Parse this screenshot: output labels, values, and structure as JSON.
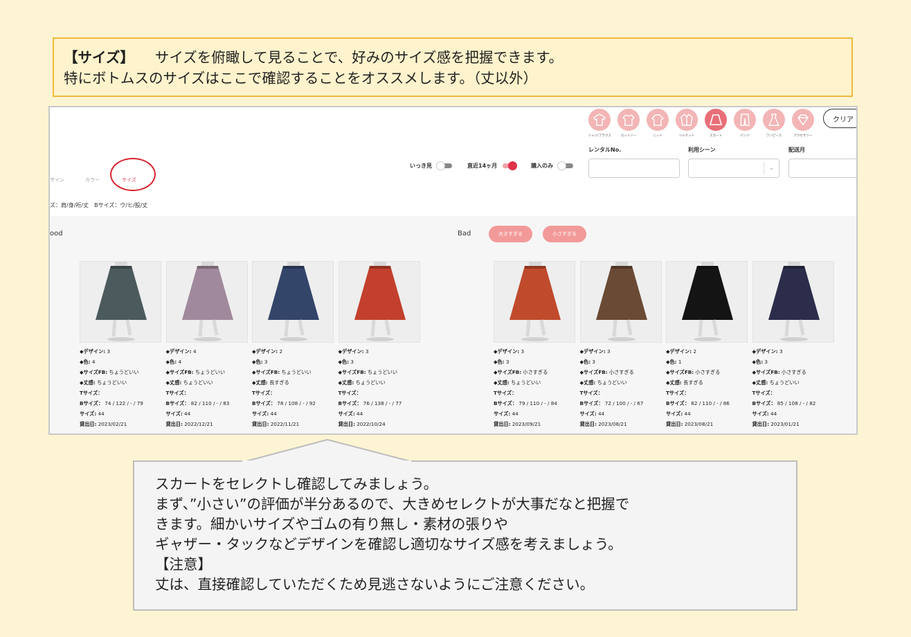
{
  "top_note": {
    "heading": "【サイズ】",
    "line1": "サイズを俯瞰して見ることで、好みのサイズ感を把握できます。",
    "line2": "特にボトムスのサイズはここで確認することをオススメします。（丈以外）"
  },
  "categories": [
    {
      "label": "シャツ/ブラウス",
      "icon": "shirt-icon"
    },
    {
      "label": "カットソー",
      "icon": "tshirt-icon"
    },
    {
      "label": "ニット",
      "icon": "knit-icon"
    },
    {
      "label": "ジャケット",
      "icon": "jacket-icon"
    },
    {
      "label": "スカート",
      "icon": "skirt-icon",
      "active": true
    },
    {
      "label": "パンツ",
      "icon": "pants-icon"
    },
    {
      "label": "ワンピース",
      "icon": "dress-icon"
    },
    {
      "label": "アクセサリー",
      "icon": "accessory-icon"
    }
  ],
  "clear_label": "クリア",
  "filters": {
    "rental_no_label": "レンタルNo.",
    "scene_label": "利用シーン",
    "month_label": "配送月"
  },
  "toggles": {
    "ikkimi": "いっき見",
    "recent": "直近14ヶ月",
    "purchase_only": "購入のみ"
  },
  "tabs": [
    "ザイン",
    "カラー",
    "サイズ"
  ],
  "legend": "ズ：肩/身/裄/丈　Bサイズ：ウ/ヒ/股/丈",
  "good_label": "ood",
  "bad_label": "Bad",
  "bad_buttons": [
    "大きすぎる",
    "小さすぎる"
  ],
  "good_items": [
    {
      "color": "#4b5a5c",
      "lines": [
        "◆デザイン: 3",
        "◆色:  4",
        "◆サイズFB: ちょうどいい",
        "◆丈感: ちょうどいい",
        "Tサイズ：",
        "Bサイズ：  74 / 122 / - / 79",
        "サイズ: 44",
        "貸出日: 2023/02/21"
      ]
    },
    {
      "color": "#a0899c",
      "lines": [
        "◆デザイン: 4",
        "◆色:  4",
        "◆サイズFB: ちょうどいい",
        "◆丈感: ちょうどいい",
        "Tサイズ：",
        "Bサイズ：  82 / 110 / - / 83",
        "サイズ: 44",
        "貸出日: 2022/12/21"
      ]
    },
    {
      "color": "#34456a",
      "lines": [
        "◆デザイン: 2",
        "◆色:  3",
        "◆サイズFB: ちょうどいい",
        "◆丈感: 長すぎる",
        "Tサイズ：",
        "Bサイズ：  78 / 108 / - / 92",
        "サイズ: 44",
        "貸出日: 2022/11/21"
      ]
    },
    {
      "color": "#c2402d",
      "lines": [
        "◆デザイン: 3",
        "◆色:  3",
        "◆サイズFB: ちょうどいい",
        "◆丈感: ちょうどいい",
        "Tサイズ：",
        "Bサイズ：  76 / 138 / - / 77",
        "サイズ: 44",
        "貸出日: 2022/10/24"
      ]
    }
  ],
  "bad_items": [
    {
      "color": "#c04a2c",
      "lines": [
        "◆デザイン: 3",
        "◆色:  3",
        "◆サイズFB: 小さすぎる",
        "◆丈感: ちょうどいい",
        "Tサイズ：",
        "Bサイズ：  79 / 110 / - / 84",
        "サイズ: 44",
        "貸出日: 2023/09/21"
      ]
    },
    {
      "color": "#6a4a35",
      "lines": [
        "◆デザイン: 3",
        "◆色:  3",
        "◆サイズFB: 小さすぎる",
        "◆丈感: ちょうどいい",
        "Tサイズ：",
        "Bサイズ：  72 / 100 / - / 67",
        "サイズ: 44",
        "貸出日: 2023/08/21"
      ]
    },
    {
      "color": "#141414",
      "lines": [
        "◆デザイン: 2",
        "◆色:  1",
        "◆サイズFB: 小さすぎる",
        "◆丈感: 長すぎる",
        "Tサイズ：",
        "Bサイズ：  82 / 110 / - / 86",
        "サイズ: 44",
        "貸出日: 2023/08/21"
      ]
    },
    {
      "color": "#2b2d4a",
      "lines": [
        "◆デザイン: 3",
        "◆色:  3",
        "◆サイズFB: 小さすぎる",
        "◆丈感: ちょうどいい",
        "Tサイズ：",
        "Bサイズ：  85 / 108 / - / 82",
        "サイズ: 44",
        "貸出日: 2023/01/21"
      ]
    }
  ],
  "callout": {
    "lines": [
      "スカートをセレクトし確認してみましょう。",
      "まず、”小さい”の評価が半分あるので、大きめセレクトが大事だなと把握で",
      "きます。細かいサイズやゴムの有り無し・素材の張りや",
      "ギャザー・タックなどデザインを確認し適切なサイズ感を考えましょう。",
      "【注意】",
      "丈は、直接確認していただくため見逃さないようにご注意ください。"
    ]
  }
}
